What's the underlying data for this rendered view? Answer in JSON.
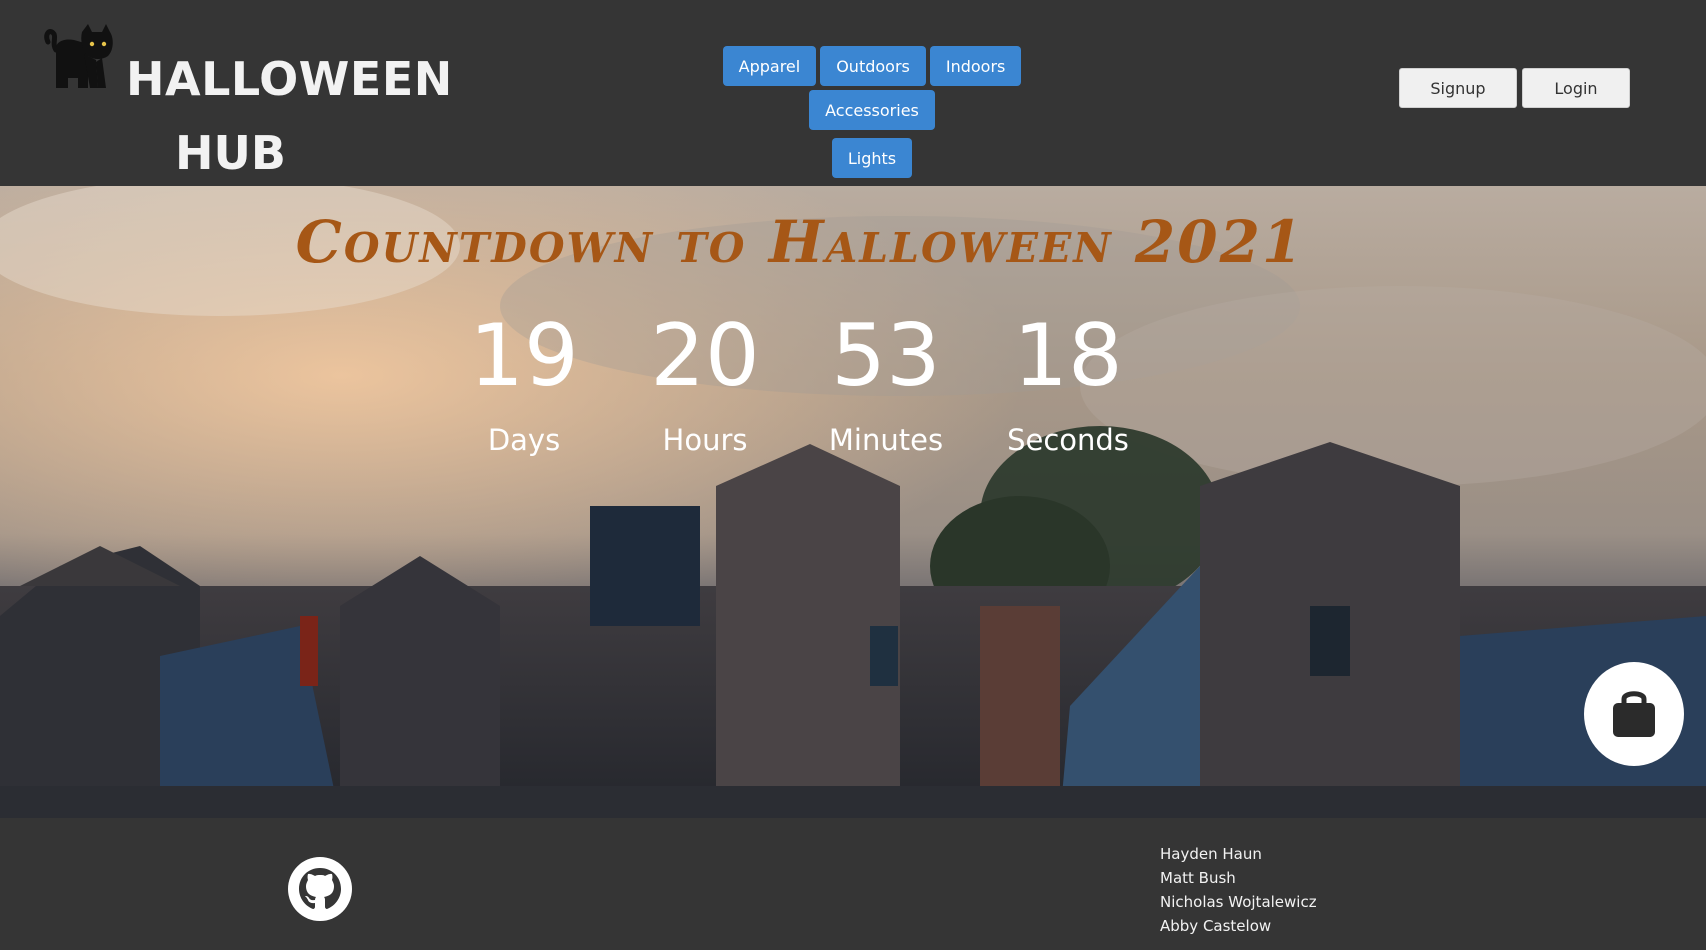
{
  "brand": {
    "title_line1": "HALLOWEEN",
    "title_line2": "HUB",
    "logo_icon": "black-cat-icon"
  },
  "nav": {
    "items": [
      {
        "label": "Apparel"
      },
      {
        "label": "Outdoors"
      },
      {
        "label": "Indoors"
      },
      {
        "label": "Accessories"
      },
      {
        "label": "Lights"
      }
    ]
  },
  "auth": {
    "signup_label": "Signup",
    "login_label": "Login"
  },
  "hero": {
    "headline": "Countdown to Halloween 2021",
    "countdown": [
      {
        "value": "19",
        "unit": "Days"
      },
      {
        "value": "20",
        "unit": "Hours"
      },
      {
        "value": "53",
        "unit": "Minutes"
      },
      {
        "value": "18",
        "unit": "Seconds"
      }
    ],
    "cart_icon": "shopping-bag-icon"
  },
  "footer": {
    "github_icon": "github-icon",
    "authors": [
      "Hayden Haun",
      "Matt Bush",
      "Nicholas Wojtalewicz",
      "Abby Castelow"
    ]
  },
  "colors": {
    "header_bg": "#353535",
    "nav_button": "#3b86d2",
    "headline": "#a65716",
    "countdown_text": "#ffffff"
  }
}
